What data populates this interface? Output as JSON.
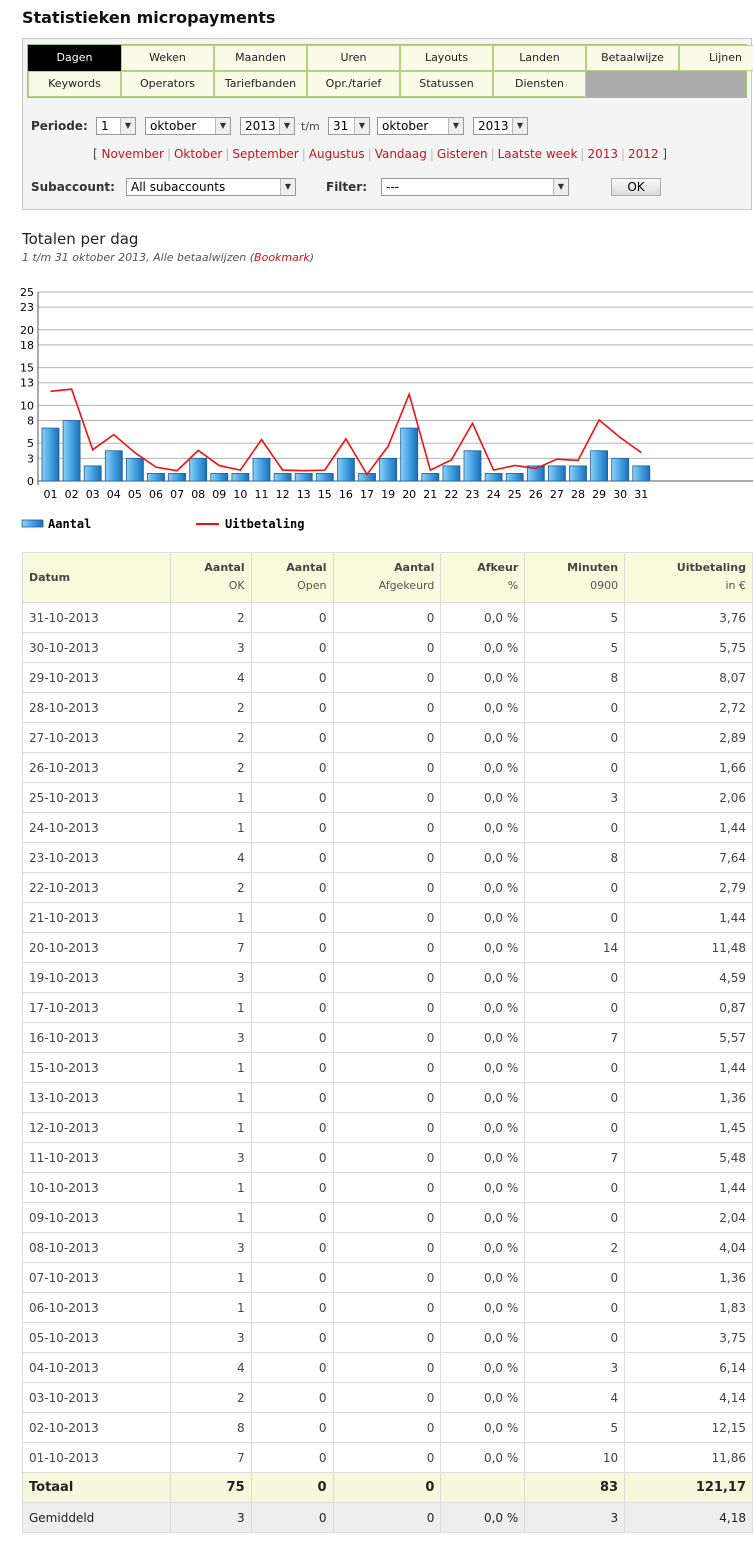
{
  "page_title": "Statistieken micropayments",
  "tabs_row1": [
    "Dagen",
    "Weken",
    "Maanden",
    "Uren",
    "Layouts",
    "Landen",
    "Betaalwijze",
    "Lijnen"
  ],
  "tabs_row2": [
    "Keywords",
    "Operators",
    "Tariefbanden",
    "Opr./tarief",
    "Statussen",
    "Diensten"
  ],
  "active_tab": "Dagen",
  "filters": {
    "periode_label": "Periode:",
    "from_day": "1",
    "from_month": "oktober",
    "from_year": "2013",
    "tm_label": "t/m",
    "to_day": "31",
    "to_month": "oktober",
    "to_year": "2013",
    "quick_links": [
      "November",
      "Oktober",
      "September",
      "Augustus",
      "Vandaag",
      "Gisteren",
      "Laatste week",
      "2013",
      "2012"
    ],
    "subaccount_label": "Subaccount:",
    "subaccount_value": "All subaccounts",
    "filter_label": "Filter:",
    "filter_value": "---",
    "ok_label": "OK"
  },
  "section": {
    "title": "Totalen per dag",
    "subtitle": "1 t/m 31 oktober 2013, Alle betaalwijzen",
    "bookmark_label": "Bookmark"
  },
  "chart_data": {
    "type": "bar",
    "categories": [
      "01",
      "02",
      "03",
      "04",
      "05",
      "06",
      "07",
      "08",
      "09",
      "10",
      "11",
      "12",
      "13",
      "15",
      "16",
      "17",
      "19",
      "20",
      "21",
      "22",
      "23",
      "24",
      "25",
      "26",
      "27",
      "28",
      "29",
      "30",
      "31"
    ],
    "series": [
      {
        "name": "Aantal",
        "type": "bar",
        "color": "#4aa3df",
        "values": [
          7,
          8,
          2,
          4,
          3,
          1,
          1,
          3,
          1,
          1,
          3,
          1,
          1,
          1,
          3,
          1,
          3,
          7,
          1,
          2,
          4,
          1,
          1,
          2,
          2,
          2,
          4,
          3,
          2
        ]
      },
      {
        "name": "Uitbetaling",
        "type": "line",
        "color": "#ee1111",
        "values": [
          11.86,
          12.15,
          4.14,
          6.14,
          3.75,
          1.83,
          1.36,
          4.04,
          2.04,
          1.44,
          5.48,
          1.45,
          1.36,
          1.44,
          5.57,
          0.87,
          4.59,
          11.48,
          1.44,
          2.79,
          7.64,
          1.44,
          2.06,
          1.66,
          2.89,
          2.72,
          8.07,
          5.75,
          3.76
        ]
      }
    ],
    "y_ticks": [
      "0",
      "3",
      "5",
      "8",
      "10",
      "13",
      "15",
      "18",
      "20",
      "23",
      "25"
    ],
    "ylim": [
      0,
      25
    ],
    "grid": true,
    "legend": "bottom-left"
  },
  "table": {
    "headers": [
      {
        "main": "Datum",
        "sub": ""
      },
      {
        "main": "Aantal",
        "sub": "OK"
      },
      {
        "main": "Aantal",
        "sub": "Open"
      },
      {
        "main": "Aantal",
        "sub": "Afgekeurd"
      },
      {
        "main": "Afkeur",
        "sub": "%"
      },
      {
        "main": "Minuten",
        "sub": "0900"
      },
      {
        "main": "Uitbetaling",
        "sub": "in €"
      }
    ],
    "rows": [
      [
        "31-10-2013",
        "2",
        "0",
        "0",
        "0,0 %",
        "5",
        "3,76"
      ],
      [
        "30-10-2013",
        "3",
        "0",
        "0",
        "0,0 %",
        "5",
        "5,75"
      ],
      [
        "29-10-2013",
        "4",
        "0",
        "0",
        "0,0 %",
        "8",
        "8,07"
      ],
      [
        "28-10-2013",
        "2",
        "0",
        "0",
        "0,0 %",
        "0",
        "2,72"
      ],
      [
        "27-10-2013",
        "2",
        "0",
        "0",
        "0,0 %",
        "0",
        "2,89"
      ],
      [
        "26-10-2013",
        "2",
        "0",
        "0",
        "0,0 %",
        "0",
        "1,66"
      ],
      [
        "25-10-2013",
        "1",
        "0",
        "0",
        "0,0 %",
        "3",
        "2,06"
      ],
      [
        "24-10-2013",
        "1",
        "0",
        "0",
        "0,0 %",
        "0",
        "1,44"
      ],
      [
        "23-10-2013",
        "4",
        "0",
        "0",
        "0,0 %",
        "8",
        "7,64"
      ],
      [
        "22-10-2013",
        "2",
        "0",
        "0",
        "0,0 %",
        "0",
        "2,79"
      ],
      [
        "21-10-2013",
        "1",
        "0",
        "0",
        "0,0 %",
        "0",
        "1,44"
      ],
      [
        "20-10-2013",
        "7",
        "0",
        "0",
        "0,0 %",
        "14",
        "11,48"
      ],
      [
        "19-10-2013",
        "3",
        "0",
        "0",
        "0,0 %",
        "0",
        "4,59"
      ],
      [
        "17-10-2013",
        "1",
        "0",
        "0",
        "0,0 %",
        "0",
        "0,87"
      ],
      [
        "16-10-2013",
        "3",
        "0",
        "0",
        "0,0 %",
        "7",
        "5,57"
      ],
      [
        "15-10-2013",
        "1",
        "0",
        "0",
        "0,0 %",
        "0",
        "1,44"
      ],
      [
        "13-10-2013",
        "1",
        "0",
        "0",
        "0,0 %",
        "0",
        "1,36"
      ],
      [
        "12-10-2013",
        "1",
        "0",
        "0",
        "0,0 %",
        "0",
        "1,45"
      ],
      [
        "11-10-2013",
        "3",
        "0",
        "0",
        "0,0 %",
        "7",
        "5,48"
      ],
      [
        "10-10-2013",
        "1",
        "0",
        "0",
        "0,0 %",
        "0",
        "1,44"
      ],
      [
        "09-10-2013",
        "1",
        "0",
        "0",
        "0,0 %",
        "0",
        "2,04"
      ],
      [
        "08-10-2013",
        "3",
        "0",
        "0",
        "0,0 %",
        "2",
        "4,04"
      ],
      [
        "07-10-2013",
        "1",
        "0",
        "0",
        "0,0 %",
        "0",
        "1,36"
      ],
      [
        "06-10-2013",
        "1",
        "0",
        "0",
        "0,0 %",
        "0",
        "1,83"
      ],
      [
        "05-10-2013",
        "3",
        "0",
        "0",
        "0,0 %",
        "0",
        "3,75"
      ],
      [
        "04-10-2013",
        "4",
        "0",
        "0",
        "0,0 %",
        "3",
        "6,14"
      ],
      [
        "03-10-2013",
        "2",
        "0",
        "0",
        "0,0 %",
        "4",
        "4,14"
      ],
      [
        "02-10-2013",
        "8",
        "0",
        "0",
        "0,0 %",
        "5",
        "12,15"
      ],
      [
        "01-10-2013",
        "7",
        "0",
        "0",
        "0,0 %",
        "10",
        "11,86"
      ]
    ],
    "total": [
      "Totaal",
      "75",
      "0",
      "0",
      "",
      "83",
      "121,17"
    ],
    "average": [
      "Gemiddeld",
      "3",
      "0",
      "0",
      "0,0 %",
      "3",
      "4,18"
    ]
  }
}
